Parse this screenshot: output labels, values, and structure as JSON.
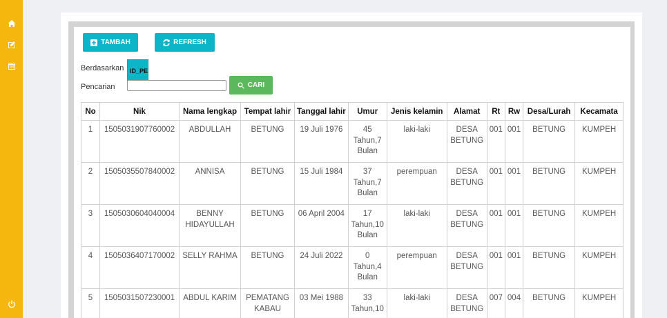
{
  "buttons": {
    "tambah": "TAMBAH",
    "refresh": "REFRESH",
    "cari": "CARI"
  },
  "filter": {
    "berdasarkan_label": "Berdasarkan",
    "berdasarkan_value": "ID_PE",
    "pencarian_label": "Pencarian",
    "search_value": ""
  },
  "sidebar_icons": [
    "home-icon",
    "edit-icon",
    "calendar-icon",
    "power-icon"
  ],
  "colors": {
    "sidebar": "#f5b70d",
    "primary_button": "#0db5c8",
    "search_button": "#5cb85c"
  },
  "table": {
    "headers": [
      "No",
      "Nik",
      "Nama lengkap",
      "Tempat lahir",
      "Tanggal lahir",
      "Umur",
      "Jenis kelamin",
      "Alamat",
      "Rt",
      "Rw",
      "Desa/Lurah",
      "Kecamata"
    ],
    "rows": [
      {
        "no": "1",
        "nik": "1505031907760002",
        "nama": "ABDULLAH",
        "tempat": "BETUNG",
        "tanggal": "19 Juli 1976",
        "umur": "45 Tahun,7 Bulan",
        "jk": "laki-laki",
        "alamat": "DESA BETUNG",
        "rt": "001",
        "rw": "001",
        "desa": "BETUNG",
        "kec": "KUMPEH"
      },
      {
        "no": "2",
        "nik": "1505035507840002",
        "nama": "ANNISA",
        "tempat": "BETUNG",
        "tanggal": "15 Juli 1984",
        "umur": "37 Tahun,7 Bulan",
        "jk": "perempuan",
        "alamat": "DESA BETUNG",
        "rt": "001",
        "rw": "001",
        "desa": "BETUNG",
        "kec": "KUMPEH"
      },
      {
        "no": "3",
        "nik": "1505030604040004",
        "nama": "BENNY HIDAYULLAH",
        "tempat": "BETUNG",
        "tanggal": "06 April 2004",
        "umur": "17 Tahun,10 Bulan",
        "jk": "laki-laki",
        "alamat": "DESA BETUNG",
        "rt": "001",
        "rw": "001",
        "desa": "BETUNG",
        "kec": "KUMPEH"
      },
      {
        "no": "4",
        "nik": "1505036407170002",
        "nama": "SELLY RAHMA",
        "tempat": "BETUNG",
        "tanggal": "24 Juli 2022",
        "umur": "0 Tahun,4 Bulan",
        "jk": "perempuan",
        "alamat": "DESA BETUNG",
        "rt": "001",
        "rw": "001",
        "desa": "BETUNG",
        "kec": "KUMPEH"
      },
      {
        "no": "5",
        "nik": "1505031507230001",
        "nama": "ABDUL KARIM",
        "tempat": "PEMATANG KABAU",
        "tanggal": "03 Mei 1988",
        "umur": "33 Tahun,10",
        "jk": "laki-laki",
        "alamat": "DESA BETUNG",
        "rt": "007",
        "rw": "004",
        "desa": "BETUNG",
        "kec": "KUMPEH"
      }
    ]
  }
}
